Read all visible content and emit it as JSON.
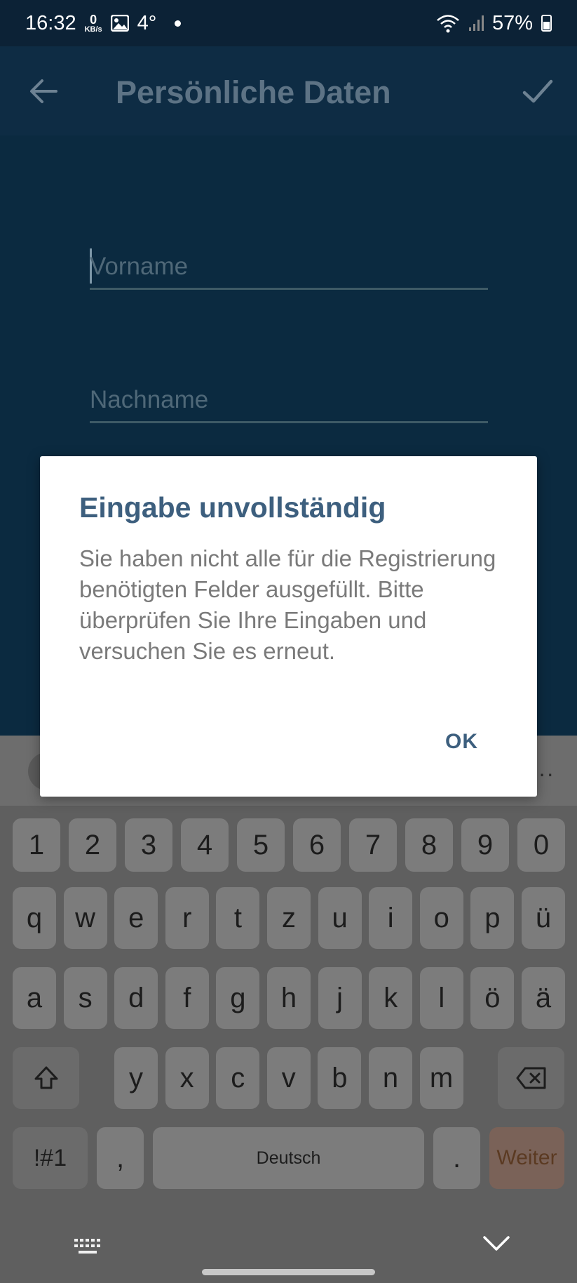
{
  "status_bar": {
    "time": "16:32",
    "net_speed_value": "0",
    "net_speed_unit": "KB/s",
    "temperature": "4°",
    "battery": "57%"
  },
  "app_bar": {
    "title": "Persönliche Daten",
    "back_icon": "arrow-left-icon",
    "confirm_icon": "check-icon"
  },
  "form": {
    "first_name_placeholder": "Vorname",
    "last_name_placeholder": "Nachname"
  },
  "dialog": {
    "title": "Eingabe unvollständig",
    "message": "Sie haben nicht alle für die Registrierung benötigten Felder ausgefüllt. Bitte überprüfen Sie Ihre Eingaben und versuchen Sie es erneut.",
    "ok_label": "OK"
  },
  "keyboard": {
    "number_row": [
      "1",
      "2",
      "3",
      "4",
      "5",
      "6",
      "7",
      "8",
      "9",
      "0"
    ],
    "row1": [
      "q",
      "w",
      "e",
      "r",
      "t",
      "z",
      "u",
      "i",
      "o",
      "p",
      "ü"
    ],
    "row2": [
      "a",
      "s",
      "d",
      "f",
      "g",
      "h",
      "j",
      "k",
      "l",
      "ö",
      "ä"
    ],
    "row3": [
      "y",
      "x",
      "c",
      "v",
      "b",
      "n",
      "m"
    ],
    "symbols_label": "!#1",
    "comma_label": ",",
    "space_label": "Deutsch",
    "period_label": ".",
    "action_label": "Weiter",
    "more_label": "···"
  },
  "colors": {
    "background": "#0b2a40",
    "app_bar": "#0e2c44",
    "dialog_accent": "#3d5f7e",
    "keyboard": "#5f5f5f"
  }
}
